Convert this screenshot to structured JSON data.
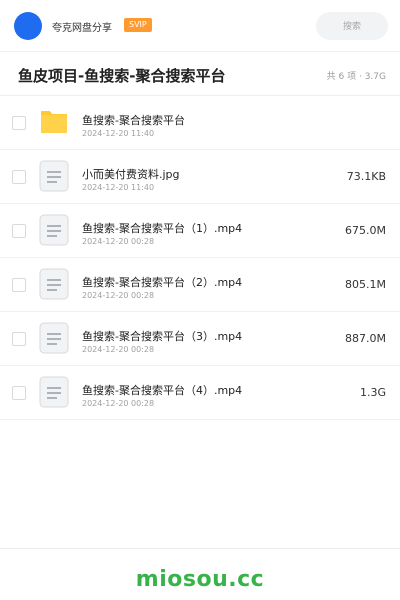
{
  "header": {
    "brand": "夸克网盘分享",
    "badge": "SVIP",
    "search_placeholder": "搜索"
  },
  "page": {
    "title": "鱼皮项目-鱼搜索-聚合搜索平台",
    "summary": "共 6 项 · 3.7G"
  },
  "files": [
    {
      "type": "folder",
      "name": "鱼搜索-聚合搜索平台",
      "date": "2024-12-20 11:40",
      "size": ""
    },
    {
      "type": "file",
      "name": "小而美付费资料.jpg",
      "date": "2024-12-20 11:40",
      "size": "73.1KB"
    },
    {
      "type": "file",
      "name": "鱼搜索-聚合搜索平台（1）.mp4",
      "date": "2024-12-20 00:28",
      "size": "675.0M"
    },
    {
      "type": "file",
      "name": "鱼搜索-聚合搜索平台（2）.mp4",
      "date": "2024-12-20 00:28",
      "size": "805.1M"
    },
    {
      "type": "file",
      "name": "鱼搜索-聚合搜索平台（3）.mp4",
      "date": "2024-12-20 00:28",
      "size": "887.0M"
    },
    {
      "type": "file",
      "name": "鱼搜索-聚合搜索平台（4）.mp4",
      "date": "2024-12-20 00:28",
      "size": "1.3G"
    }
  ],
  "footer": {
    "logo": "miosou.cc"
  },
  "colors": {
    "accent": "#1f6cf0",
    "badge": "#ff9a2e",
    "logo": "#37b34a",
    "folder": "#ffc933"
  }
}
